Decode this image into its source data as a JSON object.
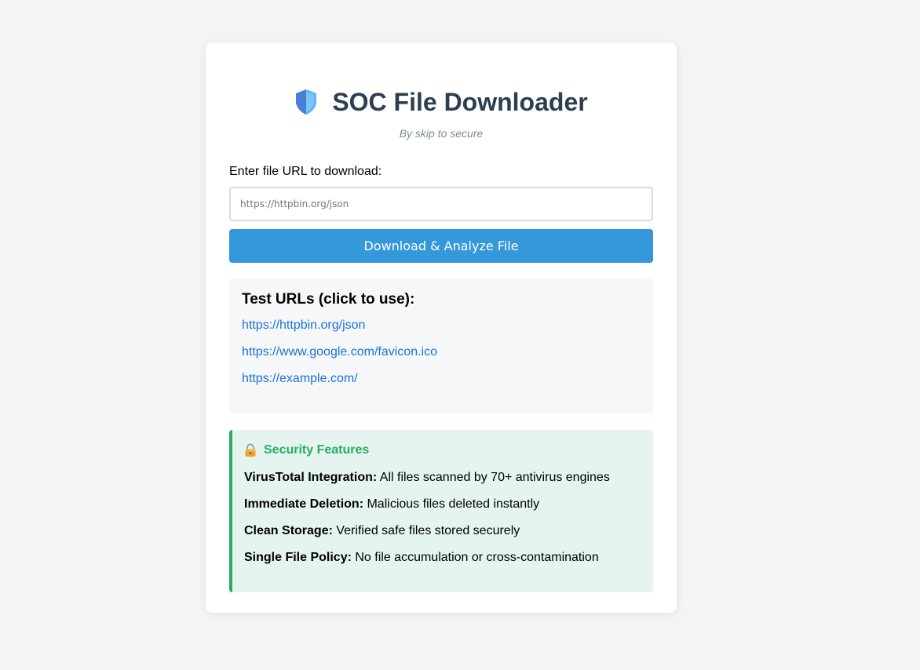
{
  "header": {
    "title": "SOC File Downloader",
    "subtitle": "By skip to secure",
    "icon": "shield-icon"
  },
  "form": {
    "label": "Enter file URL to download:",
    "url_value": "",
    "url_placeholder": "https://httpbin.org/json",
    "submit_label": "Download & Analyze File"
  },
  "test_urls": {
    "title": "Test URLs (click to use):",
    "links": [
      "https://httpbin.org/json",
      "https://www.google.com/favicon.ico",
      "https://example.com/"
    ]
  },
  "security": {
    "title": "Security Features",
    "icon": "lock-icon",
    "features": [
      {
        "name": "VirusTotal Integration:",
        "desc": " All files scanned by 70+ antivirus engines"
      },
      {
        "name": "Immediate Deletion:",
        "desc": " Malicious files deleted instantly"
      },
      {
        "name": "Clean Storage:",
        "desc": " Verified safe files stored securely"
      },
      {
        "name": "Single File Policy:",
        "desc": " No file accumulation or cross-contamination"
      }
    ]
  },
  "colors": {
    "accent": "#3498db",
    "title": "#2c3e50",
    "link": "#1a73d6",
    "security_green": "#27ae60",
    "security_bg": "#e5f4f0"
  }
}
